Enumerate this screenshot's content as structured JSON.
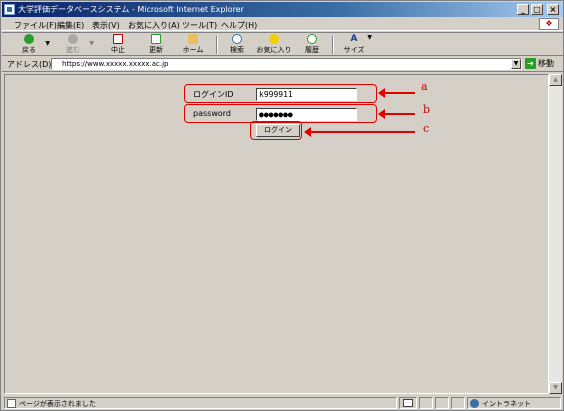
{
  "window": {
    "title": "大学評価データベースシステム - Microsoft Internet Explorer",
    "minimize": "_",
    "maximize": "□",
    "close": "×"
  },
  "menu": {
    "items": [
      "ファイル(F)",
      "編集(E)",
      "表示(V)",
      "お気に入り(A)",
      "ツール(T)",
      "ヘルプ(H)"
    ]
  },
  "toolbar": {
    "back": "戻る",
    "forward": "進む",
    "stop": "中止",
    "refresh": "更新",
    "home": "ホーム",
    "search": "検索",
    "favorites": "お気に入り",
    "history": "履歴",
    "size": "サイズ"
  },
  "address": {
    "label": "アドレス(D)",
    "url": "https://www.xxxxx.xxxxx.ac.jp",
    "go": "移動"
  },
  "login": {
    "id_label": "ログインID",
    "id_value": "k999911",
    "password_label": "password",
    "password_value": "●●●●●●●",
    "button": "ログイン"
  },
  "annotations": {
    "a": "a",
    "b": "b",
    "c": "c"
  },
  "status": {
    "text": "ページが表示されました",
    "zone": "イントラネット"
  },
  "colors": {
    "title_bar": "#0a246a",
    "annotation": "#e00000",
    "chrome": "#d4d0c8"
  }
}
